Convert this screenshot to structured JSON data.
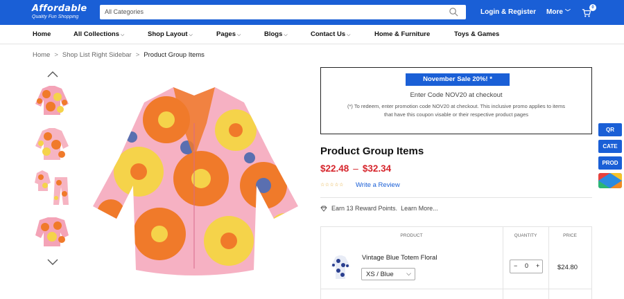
{
  "header": {
    "logo_name": "Affordable",
    "logo_tagline": "Quality Fun Shopping",
    "search_placeholder": "All Categories",
    "login_label": "Login & Register",
    "more_label": "More",
    "cart_count": "0",
    "accent_color": "#1a5fd6"
  },
  "nav": {
    "items": [
      {
        "label": "Home",
        "dropdown": false
      },
      {
        "label": "All Collections",
        "dropdown": true
      },
      {
        "label": "Shop Layout",
        "dropdown": true
      },
      {
        "label": "Pages",
        "dropdown": true
      },
      {
        "label": "Blogs",
        "dropdown": true
      },
      {
        "label": "Contact Us",
        "dropdown": true
      },
      {
        "label": "Home & Furniture",
        "dropdown": false
      },
      {
        "label": "Toys & Games",
        "dropdown": false
      }
    ]
  },
  "breadcrumb": {
    "items": [
      "Home",
      "Shop List Right Sidebar",
      "Product Group Items"
    ]
  },
  "gallery": {
    "thumbnail_icons": [
      "floral-shirt-thumbnail",
      "floral-shirt-back-thumbnail",
      "floral-set-thumbnail",
      "floral-shirt-folded-thumbnail"
    ],
    "main_image_icon": "floral-shirt-main-image"
  },
  "promo": {
    "badge": "November Sale 20%! *",
    "code_line": "Enter Code NOV20 at checkout",
    "note": "(*) To redeem, enter promotion code NOV20 at checkout. This inclusive promo applies to items that have this coupon visable or their respective product pages"
  },
  "product": {
    "title": "Product Group Items",
    "price_min": "$22.48",
    "price_sep": "–",
    "price_max": "$32.34",
    "rating_stars": "☆☆☆☆☆",
    "review_link": "Write a Review",
    "reward_text": "Earn 13 Reward Points.",
    "reward_link": "Learn More...",
    "price_color": "#d6252c"
  },
  "group_table": {
    "headers": {
      "product": "PRODUCT",
      "quantity": "QUANTITY",
      "price": "PRICE"
    },
    "rows": [
      {
        "name": "Vintage Blue Totem Floral",
        "variant": "XS / Blue",
        "quantity": "0",
        "minus": "−",
        "plus": "+",
        "price": "$24.80"
      }
    ]
  },
  "side_tabs": [
    "QR",
    "CATE",
    "PROD"
  ]
}
